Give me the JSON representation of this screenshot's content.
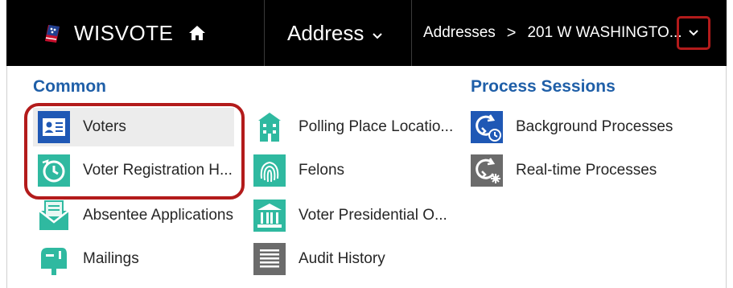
{
  "header": {
    "app_name": "WISVOTE",
    "logo_icon": "flag-logo-icon",
    "home_icon": "home-icon",
    "entity_label": "Address",
    "breadcrumb": {
      "parent": "Addresses",
      "separator": ">",
      "current": "201 W WASHINGTO..."
    }
  },
  "menu": {
    "common": {
      "title": "Common",
      "items": [
        {
          "label": "Voters",
          "icon": "voters-id-card-icon",
          "selected": true
        },
        {
          "label": "Voter Registration H...",
          "icon": "clock-history-icon"
        },
        {
          "label": "Absentee Applications",
          "icon": "absentee-envelope-icon"
        },
        {
          "label": "Mailings",
          "icon": "mailbox-icon"
        },
        {
          "label": "Polling Place Locatio...",
          "icon": "polling-place-building-icon"
        },
        {
          "label": "Felons",
          "icon": "fingerprint-icon"
        },
        {
          "label": "Voter Presidential O...",
          "icon": "government-building-icon"
        },
        {
          "label": "Audit History",
          "icon": "audit-list-icon"
        }
      ]
    },
    "process_sessions": {
      "title": "Process Sessions",
      "items": [
        {
          "label": "Background Processes",
          "icon": "background-process-icon"
        },
        {
          "label": "Real-time Processes",
          "icon": "realtime-process-icon"
        }
      ]
    }
  },
  "colors": {
    "topbar": "#000000",
    "accent_blue": "#1f5fa8",
    "highlight_red": "#b31b1b",
    "teal": "#2fb9a0",
    "process_blue": "#1f58b5",
    "gray_icon": "#6b6b6b"
  }
}
